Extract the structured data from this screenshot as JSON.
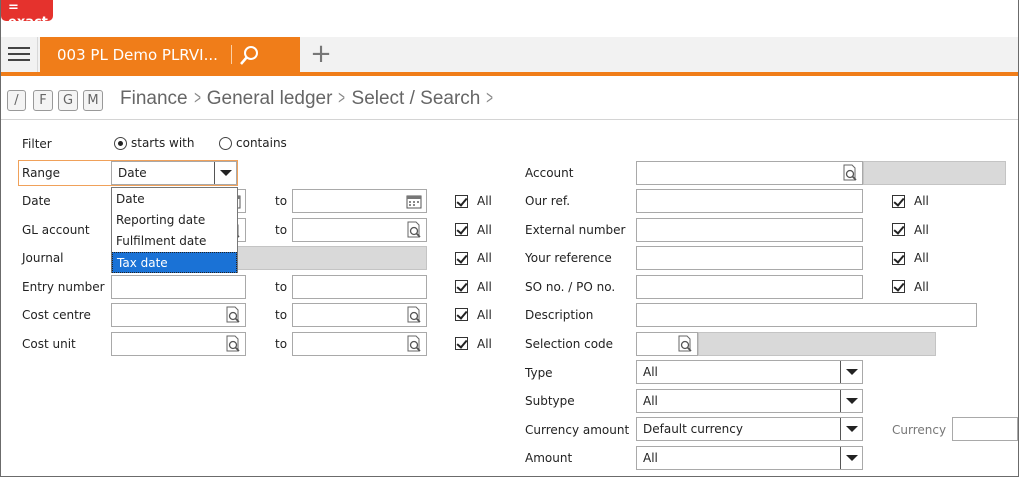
{
  "app": {
    "logo_text": "= exact",
    "tab_title": "003  PL Demo PLRVI...",
    "brand_color": "#f07d19",
    "logo_color": "#e5322d",
    "add_tab_symbol": "+"
  },
  "shortcut_keys": [
    "/",
    "F",
    "G",
    "M"
  ],
  "breadcrumb": [
    "Finance",
    "General ledger",
    "Select / Search"
  ],
  "breadcrumb_separator": ">",
  "filter": {
    "label": "Filter",
    "options": [
      "starts with",
      "contains"
    ],
    "selected": "starts with"
  },
  "range": {
    "label": "Range",
    "value": "Date",
    "options": [
      "Date",
      "Reporting date",
      "Fulfilment date",
      "Tax date"
    ],
    "highlighted": "Tax date"
  },
  "left_fields": {
    "date": "Date",
    "gl_account": "GL account",
    "journal": "Journal",
    "entry_number": "Entry number",
    "cost_centre": "Cost centre",
    "cost_unit": "Cost unit"
  },
  "to_label": "to",
  "all_label": "All",
  "right_fields": {
    "account": "Account",
    "our_ref": "Our ref.",
    "external_number": "External number",
    "your_reference": "Your reference",
    "so_po_no": "SO no. / PO no.",
    "description": "Description",
    "selection_code": "Selection code",
    "type": "Type",
    "subtype": "Subtype",
    "currency_amount": "Currency amount",
    "amount": "Amount",
    "currency": "Currency"
  },
  "selects": {
    "type_value": "All",
    "subtype_value": "All",
    "currency_amount_value": "Default currency",
    "amount_value": "All"
  },
  "icons": {
    "search": "search-icon",
    "lookup": "lookup-icon",
    "calendar": "calendar-icon",
    "menu": "hamburger-menu-icon",
    "dropdown": "chevron-down-icon"
  }
}
